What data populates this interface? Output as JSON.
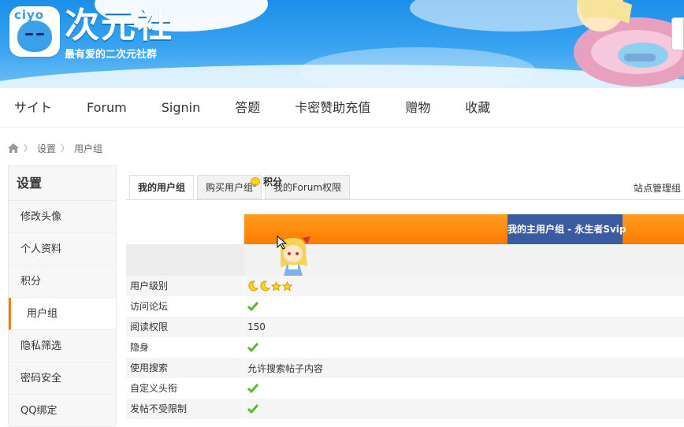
{
  "header": {
    "logo_tag": "ciyo",
    "logo_title": "次元社",
    "logo_subtitle": "最有爱的二次元社群"
  },
  "nav": {
    "items": [
      {
        "label": "サイト"
      },
      {
        "label": "Forum"
      },
      {
        "label": "Signin"
      },
      {
        "label": "答题"
      },
      {
        "label": "卡密赞助充值"
      },
      {
        "label": "赠物"
      },
      {
        "label": "收藏"
      }
    ]
  },
  "breadcrumb": {
    "icon": "home-icon",
    "items": [
      "设置",
      "用户组"
    ]
  },
  "sidebar": {
    "title": "设置",
    "items": [
      {
        "label": "修改头像"
      },
      {
        "label": "个人资料"
      },
      {
        "label": "积分"
      },
      {
        "label": "用户组",
        "active": true
      },
      {
        "label": "隐私筛选"
      },
      {
        "label": "密码安全"
      },
      {
        "label": "QQ绑定"
      }
    ]
  },
  "main": {
    "tabs": [
      {
        "label": "我的用户组",
        "active": true
      },
      {
        "label": "购买用户组"
      },
      {
        "label": "我的Forum权限"
      }
    ],
    "admin_link": "站点管理组",
    "group_label": "我的主用户组 - 永生者Svip",
    "score_header": "积分",
    "rows": [
      {
        "key": "用户级别",
        "type": "level"
      },
      {
        "key": "访问论坛",
        "type": "check"
      },
      {
        "key": "阅读权限",
        "type": "text",
        "value": "150"
      },
      {
        "key": "隐身",
        "type": "check"
      },
      {
        "key": "使用搜索",
        "type": "text",
        "value": "允许搜索帖子内容"
      },
      {
        "key": "自定义头衔",
        "type": "check"
      },
      {
        "key": "发帖不受限制",
        "type": "check"
      }
    ]
  },
  "colors": {
    "accent": "#ff7a00",
    "group_bg": "#3b5ba0",
    "check": "#5cb82b",
    "banner": "#3aa4f0"
  }
}
